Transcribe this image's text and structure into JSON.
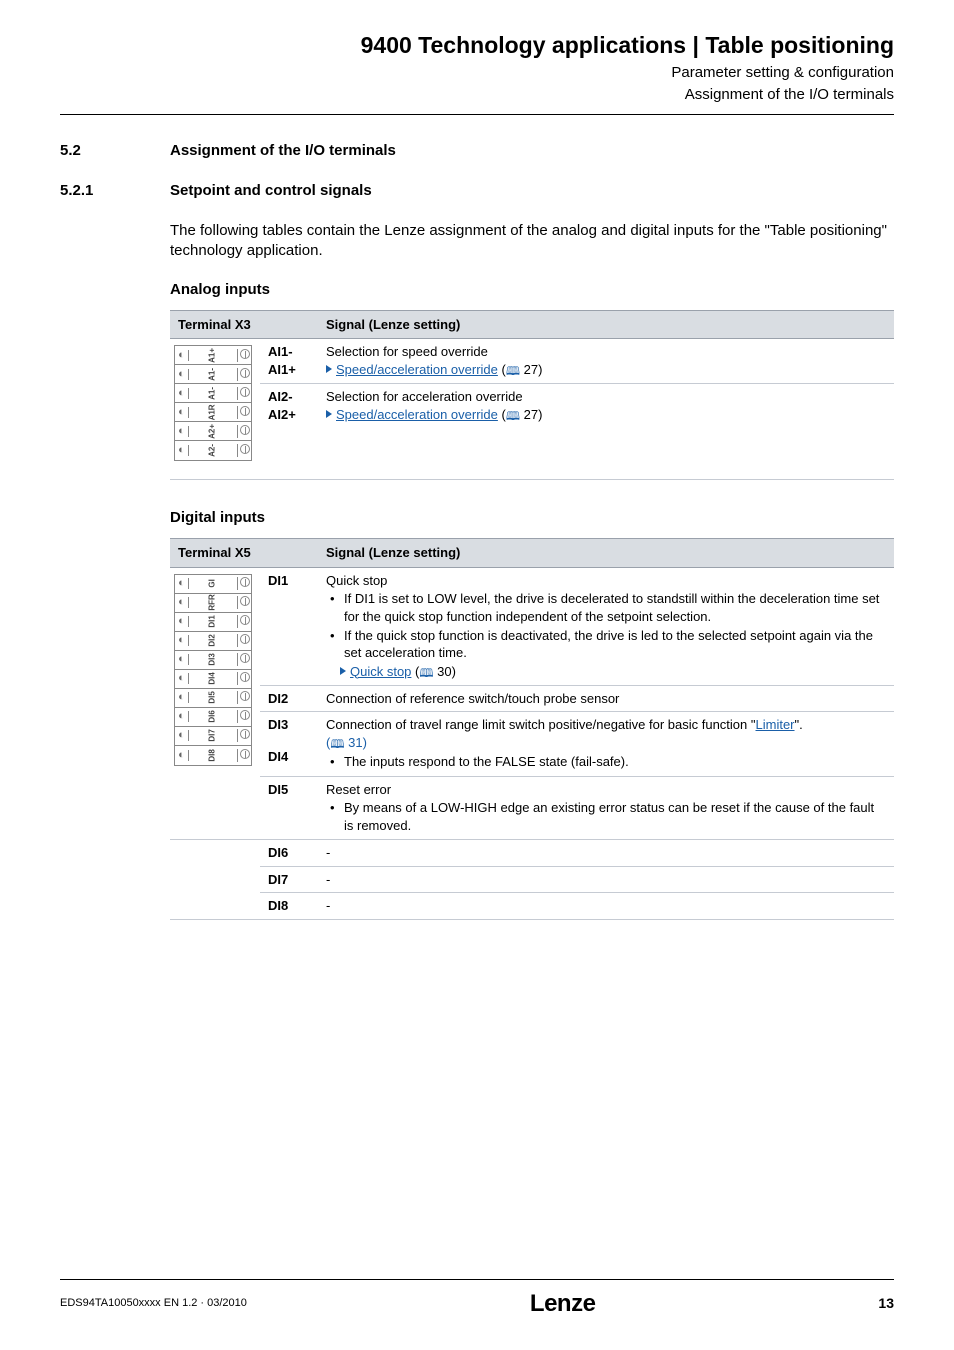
{
  "header": {
    "title": "9400 Technology applications | Table positioning",
    "sub1": "Parameter setting & configuration",
    "sub2": "Assignment of the I/O terminals"
  },
  "sections": {
    "s52_num": "5.2",
    "s52_title": "Assignment of the I/O terminals",
    "s521_num": "5.2.1",
    "s521_title": "Setpoint and control signals"
  },
  "intro": "The following tables contain the Lenze assignment of the analog and digital inputs for the \"Table positioning\" technology application.",
  "analog": {
    "heading": "Analog inputs",
    "th_terminal": "Terminal X3",
    "th_signal": "Signal (Lenze setting)",
    "terminal_pins": [
      "A1+",
      "A1-",
      "A1-",
      "A1R",
      "A2+",
      "A2-"
    ],
    "rows": [
      {
        "id_a": "AI1-",
        "id_b": "AI1+",
        "desc": "Selection for speed override",
        "link": "Speed/acceleration override",
        "ref": " 27)"
      },
      {
        "id_a": "AI2-",
        "id_b": "AI2+",
        "desc": "Selection for acceleration override",
        "link": "Speed/acceleration override",
        "ref": " 27)"
      }
    ]
  },
  "digital": {
    "heading": "Digital inputs",
    "th_terminal": "Terminal X5",
    "th_signal": "Signal (Lenze setting)",
    "terminal_pins": [
      "GI",
      "RFR",
      "DI1",
      "DI2",
      "DI3",
      "DI4",
      "DI5",
      "DI6",
      "DI7",
      "DI8"
    ],
    "rows": {
      "di1": {
        "id": "DI1",
        "title": "Quick stop",
        "b1": "If DI1 is set to LOW level, the drive is decelerated to standstill within the deceleration time set for the quick stop function independent of the setpoint selection.",
        "b2": "If the quick stop function is deactivated, the drive is led to the selected setpoint again via the set acceleration time.",
        "link": "Quick stop",
        "ref": " 30)"
      },
      "di2": {
        "id": "DI2",
        "text": "Connection of reference switch/touch probe sensor"
      },
      "di34": {
        "id3": "DI3",
        "id4": "DI4",
        "text_a": "Connection of travel range limit switch positive/negative for basic function \"",
        "link1": "Limiter",
        "text_b": "\".",
        "ref": " 31)",
        "b1": "The inputs respond to the FALSE state (fail-safe)."
      },
      "di5": {
        "id": "DI5",
        "title": "Reset error",
        "b1": "By means of a LOW-HIGH edge an existing error status can be reset if the cause of the fault is removed."
      },
      "di6": {
        "id": "DI6",
        "text": "-"
      },
      "di7": {
        "id": "DI7",
        "text": "-"
      },
      "di8": {
        "id": "DI8",
        "text": "-"
      }
    }
  },
  "footer": {
    "doc": "EDS94TA10050xxxx EN 1.2 · 03/2010",
    "brand": "Lenze",
    "page": "13"
  }
}
